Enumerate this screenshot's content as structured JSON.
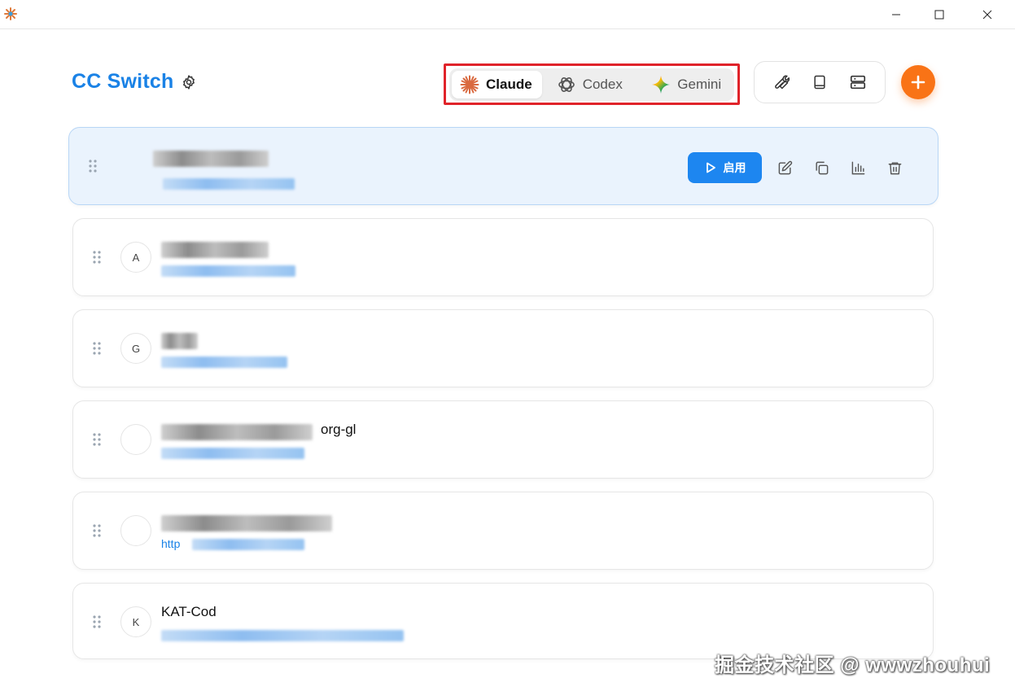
{
  "window": {
    "minimize_glyph": "—",
    "maximize_glyph": "☐",
    "close_glyph": "✕"
  },
  "header": {
    "brand": "CC Switch",
    "tabs": [
      {
        "label": "Claude",
        "icon": "claude-starburst-icon",
        "active": true
      },
      {
        "label": "Codex",
        "icon": "openai-knot-icon",
        "active": false
      },
      {
        "label": "Gemini",
        "icon": "gemini-sparkle-icon",
        "active": false
      }
    ],
    "tools": [
      "wrench-icon",
      "book-icon",
      "server-icon"
    ],
    "add_icon": "plus-icon"
  },
  "providers": [
    {
      "avatar": "",
      "name": "",
      "url": "",
      "selected": true
    },
    {
      "avatar": "A",
      "name": "",
      "url": "",
      "selected": false
    },
    {
      "avatar": "G",
      "name": "",
      "url": "",
      "selected": false
    },
    {
      "avatar": "",
      "name": "org-gl",
      "url": "",
      "selected": false
    },
    {
      "avatar": "",
      "name": "",
      "url": "http",
      "selected": false
    },
    {
      "avatar": "K",
      "name": "KAT-Cod",
      "url": "",
      "selected": false
    }
  ],
  "actions": {
    "enable_label": "启用",
    "icons": [
      "edit-icon",
      "duplicate-icon",
      "usage-chart-icon",
      "delete-icon"
    ]
  },
  "watermark": "掘金技术社区 @ wwwzhouhui",
  "colors": {
    "brand_blue": "#1a82e6",
    "accent_orange": "#f97316",
    "highlight_red": "#e0232a",
    "selected_card_bg": "#eaf3fd"
  }
}
